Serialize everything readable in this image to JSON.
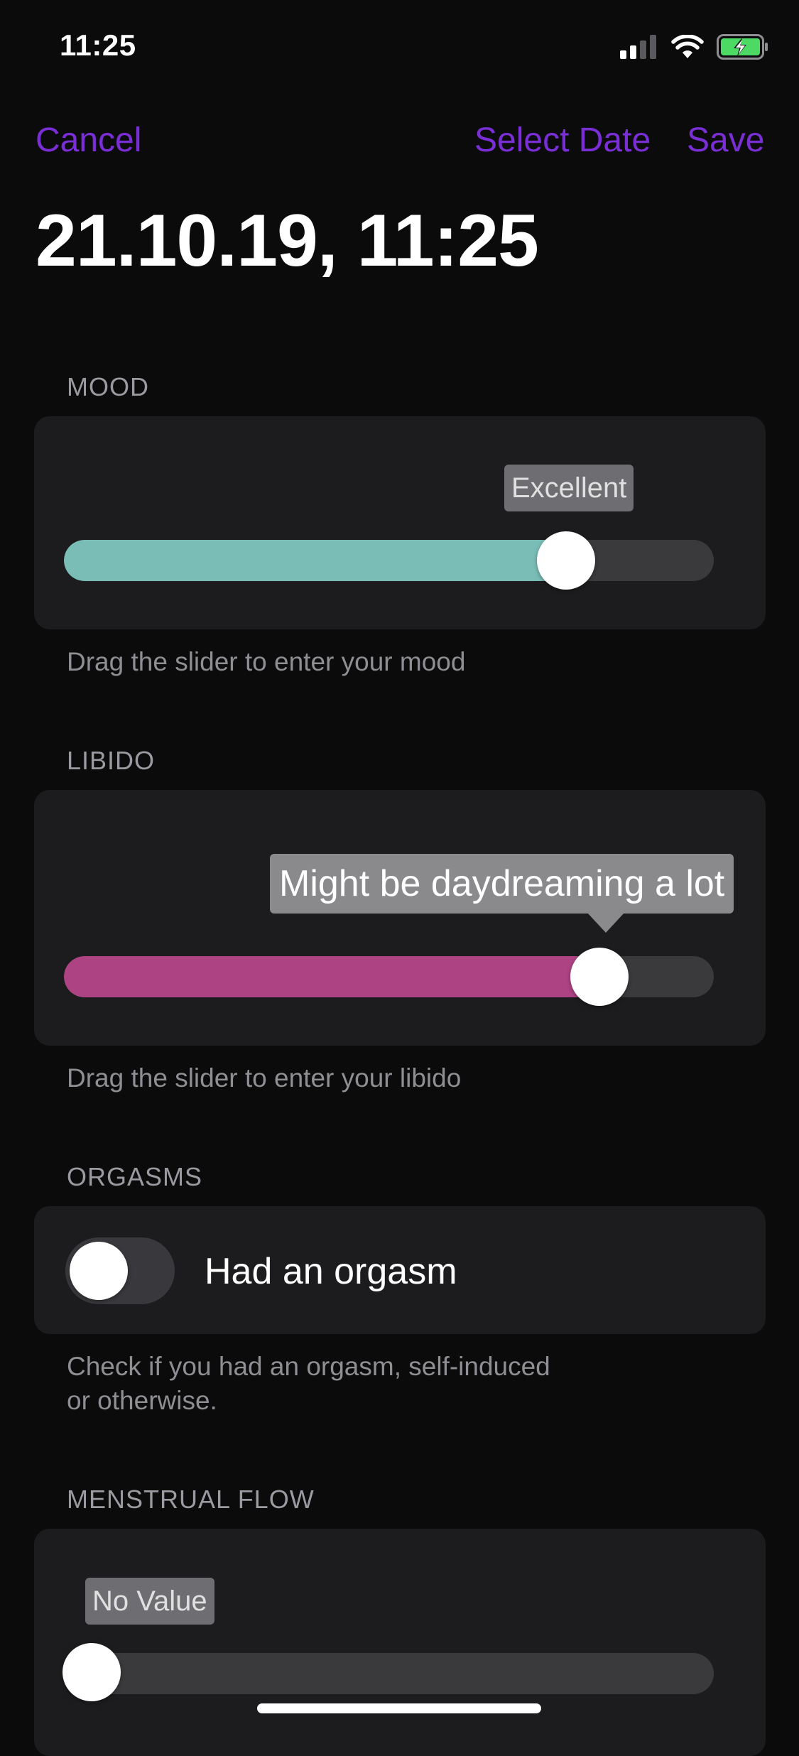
{
  "status_bar": {
    "time": "11:25",
    "icons": [
      "cellular-signal-icon",
      "wifi-icon",
      "battery-charging-icon"
    ]
  },
  "nav": {
    "cancel_label": "Cancel",
    "select_date_label": "Select Date",
    "save_label": "Save"
  },
  "title": "21.10.19, 11:25",
  "mood": {
    "header": "MOOD",
    "value_label": "Excellent",
    "value_fraction": 0.77,
    "fill_color": "#79bdb6",
    "helper": "Drag the slider to enter your mood"
  },
  "libido": {
    "header": "LIBIDO",
    "value_label": "Might be daydreaming a lot",
    "value_fraction": 0.82,
    "fill_color": "#ad4383",
    "helper": "Drag the slider to enter your libido"
  },
  "orgasms": {
    "header": "ORGASMS",
    "toggle_label": "Had an orgasm",
    "toggle_on": false,
    "helper_line1": "Check if you had an orgasm, self-induced",
    "helper_line2": "or otherwise."
  },
  "menstrual_flow": {
    "header": "MENSTRUAL FLOW",
    "value_label": "No Value",
    "value_fraction": 0.0
  },
  "colors": {
    "accent": "#7a2fd6",
    "background": "#0b0b0c",
    "card": "#1c1c1e"
  }
}
